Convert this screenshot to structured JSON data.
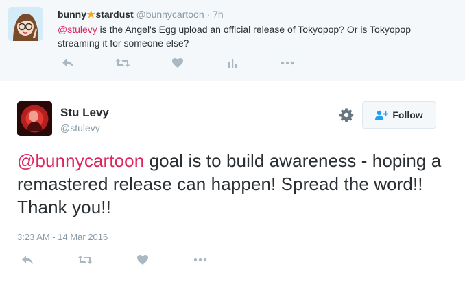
{
  "parent_tweet": {
    "name_part1": "bunny",
    "name_star": "★",
    "name_part2": "stardust",
    "handle": "@bunnycartoon",
    "separator": "·",
    "time": "7h",
    "mention": "@stulevy",
    "text": " is the Angel's Egg upload an official release of Tokyopop? Or is Tokyopop streaming it for someone else?",
    "actions": [
      "reply-icon",
      "retweet-icon",
      "like-icon",
      "analytics-icon",
      "more-icon"
    ]
  },
  "main_tweet": {
    "name": "Stu Levy",
    "handle": "@stulevy",
    "follow_label": "Follow",
    "mention": "@bunnycartoon",
    "text": " goal is to build awareness - hoping a remastered release can happen!  Spread the word!!  Thank you!!",
    "timestamp": "3:23 AM - 14 Mar 2016",
    "actions": [
      "reply-icon",
      "retweet-icon",
      "like-icon",
      "more-icon"
    ]
  },
  "colors": {
    "mention": "#e0245e",
    "secondary_text": "#8899a6",
    "icon": "#aab8c2",
    "parent_bg": "#f5f8fa",
    "follow_icon": "#1da1f2"
  }
}
